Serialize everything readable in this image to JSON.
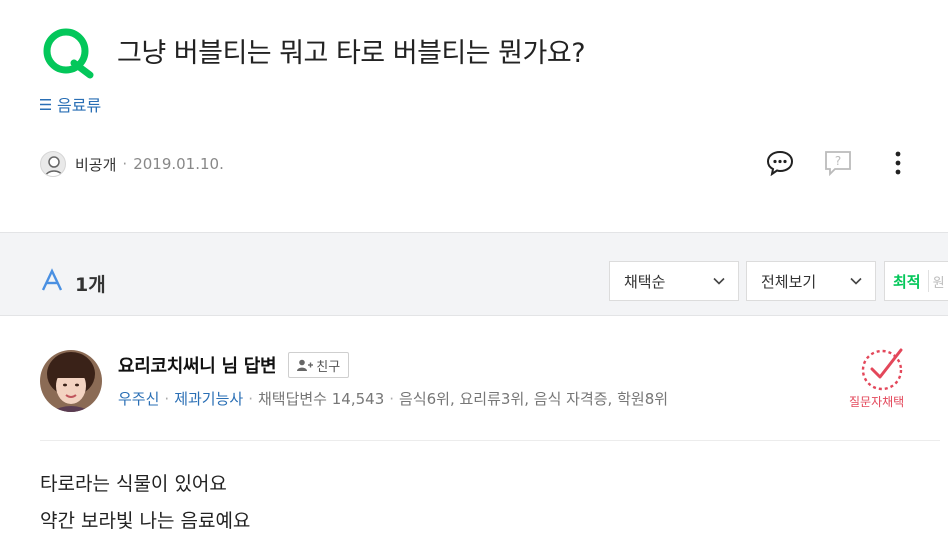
{
  "question": {
    "title": "그냥 버블티는 뭐고 타로 버블티는 뭔가요?",
    "category": "음료류",
    "author": "비공개",
    "date": "2019.01.10."
  },
  "answers_bar": {
    "count": "1개",
    "sort_select": "채택순",
    "view_select": "전체보기",
    "sort_tab_active": "최적",
    "sort_tab_next": "원"
  },
  "answer": {
    "name": "요리코치써니 님 답변",
    "friend_button": "친구",
    "meta": {
      "rank": "우주신",
      "cert": "제과기능사",
      "stats": "채택답변수 14,543",
      "tags": "음식6위, 요리류3위, 음식 자격증, 학원8위"
    },
    "selected_label": "질문자채택",
    "body_lines": [
      "타로라는 식물이 있어요",
      "약간 보라빛 나는 음료예요"
    ]
  },
  "icons": {
    "q_logo": "q-logo-icon",
    "category": "menu-icon",
    "comment": "comment-icon",
    "report": "report-icon",
    "more": "more-icon",
    "answer": "a-icon",
    "add_friend": "add-friend-icon",
    "selected": "check-stamp-icon"
  },
  "colors": {
    "brand_green": "#03c75a",
    "link_blue": "#2a6fb5",
    "selected_red": "#e3475a",
    "answer_a_blue": "#4a90e2"
  }
}
